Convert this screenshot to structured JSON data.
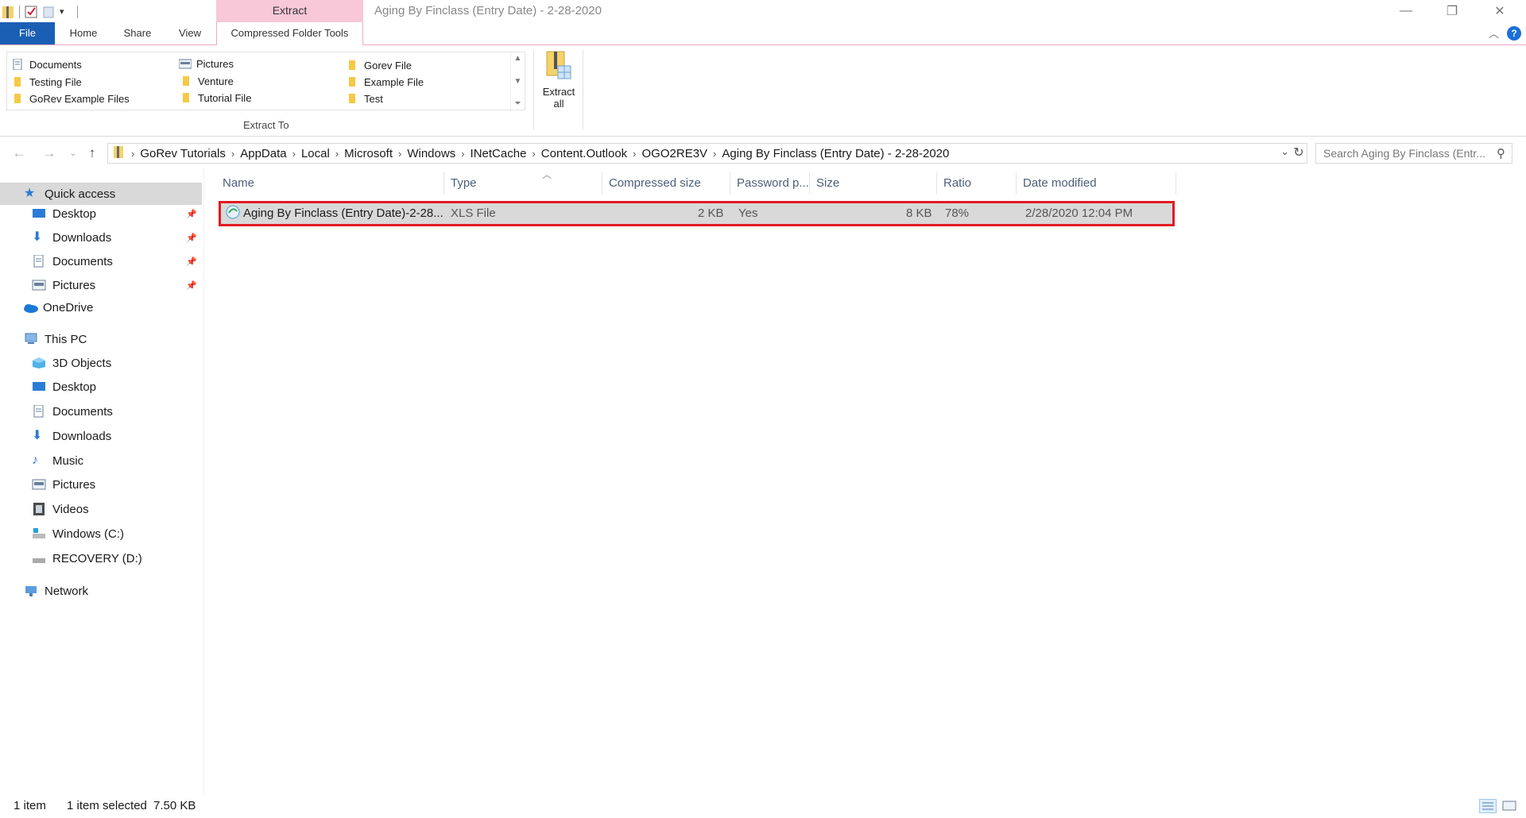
{
  "window": {
    "title": "Aging By Finclass (Entry Date) - 2-28-2020",
    "context_tab_header": "Extract"
  },
  "ribbon": {
    "tabs": [
      "File",
      "Home",
      "Share",
      "View",
      "Compressed Folder Tools"
    ],
    "gallery": [
      {
        "label": "Documents",
        "icon": "documents-icon"
      },
      {
        "label": "Testing File",
        "icon": "folder-icon"
      },
      {
        "label": "GoRev Example Files",
        "icon": "folder-icon"
      },
      {
        "label": "Pictures",
        "icon": "pictures-icon"
      },
      {
        "label": "Venture",
        "icon": "folder-icon"
      },
      {
        "label": "Tutorial File",
        "icon": "folder-icon"
      },
      {
        "label": "Gorev File",
        "icon": "folder-icon"
      },
      {
        "label": "Example File",
        "icon": "folder-icon"
      },
      {
        "label": "Test",
        "icon": "folder-icon"
      }
    ],
    "group_label": "Extract To",
    "extract_all": {
      "line1": "Extract",
      "line2": "all"
    }
  },
  "address": {
    "crumbs": [
      "GoRev Tutorials",
      "AppData",
      "Local",
      "Microsoft",
      "Windows",
      "INetCache",
      "Content.Outlook",
      "OGO2RE3V",
      "Aging By Finclass (Entry Date) - 2-28-2020"
    ],
    "search_placeholder": "Search Aging By Finclass (Entr..."
  },
  "sidebar": {
    "quick_access": "Quick access",
    "quick_items": [
      "Desktop",
      "Downloads",
      "Documents",
      "Pictures"
    ],
    "onedrive": "OneDrive",
    "this_pc": "This PC",
    "pc_items": [
      "3D Objects",
      "Desktop",
      "Documents",
      "Downloads",
      "Music",
      "Pictures",
      "Videos",
      "Windows (C:)",
      "RECOVERY (D:)"
    ],
    "network": "Network"
  },
  "columns": [
    "Name",
    "Type",
    "Compressed size",
    "Password p...",
    "Size",
    "Ratio",
    "Date modified"
  ],
  "files": [
    {
      "name": "Aging By Finclass (Entry Date)-2-28...",
      "type": "XLS File",
      "compressed_size": "2 KB",
      "password": "Yes",
      "size": "8 KB",
      "ratio": "78%",
      "date_modified": "2/28/2020 12:04 PM"
    }
  ],
  "status": {
    "item_count": "1 item",
    "selection": "1 item selected",
    "selection_size": "7.50 KB"
  },
  "colors": {
    "file_tab": "#1a5fb4",
    "context_tab": "#f8c8d9",
    "highlight_border": "#e01b24",
    "selection": "#d9d9d9"
  }
}
